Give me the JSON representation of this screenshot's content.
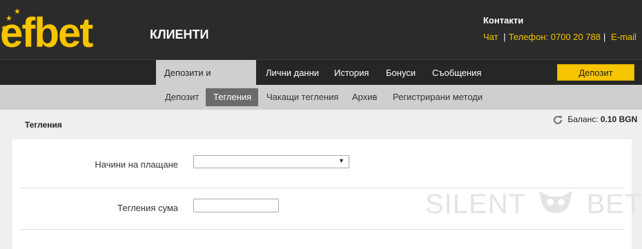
{
  "header": {
    "logo_text": "efbet",
    "subtitle": "КЛИЕНТИ",
    "contacts_title": "Контакти",
    "contacts": {
      "chat": "Чат",
      "phone": "Телефон: 0700 20 788",
      "email": "E-mail"
    }
  },
  "main_nav": {
    "items": [
      {
        "label": "Депозити и Тегления",
        "active": true
      },
      {
        "label": "Лични данни"
      },
      {
        "label": "История"
      },
      {
        "label": "Бонуси"
      },
      {
        "label": "Съобщения"
      }
    ],
    "deposit_button": "Депозит"
  },
  "sub_nav": {
    "items": [
      {
        "label": "Депозит"
      },
      {
        "label": "Тегления",
        "active": true
      },
      {
        "label": "Чакащи тегления"
      },
      {
        "label": "Архив"
      },
      {
        "label": "Регистрирани методи"
      }
    ]
  },
  "page": {
    "title": "Тегления",
    "balance_label": "Баланс:",
    "balance_value": "0.10 BGN"
  },
  "form": {
    "payment_methods_label": "Начини на плащане",
    "payment_methods_value": "",
    "amount_label": "Тегления сума",
    "amount_value": ""
  },
  "watermark": {
    "left": "SILENT",
    "right": "BET"
  },
  "colors": {
    "brand_yellow": "#f6c400",
    "header_bg": "#2b2b2b",
    "active_tab": "#cfcfcf",
    "active_subtab": "#6b6b6b"
  }
}
